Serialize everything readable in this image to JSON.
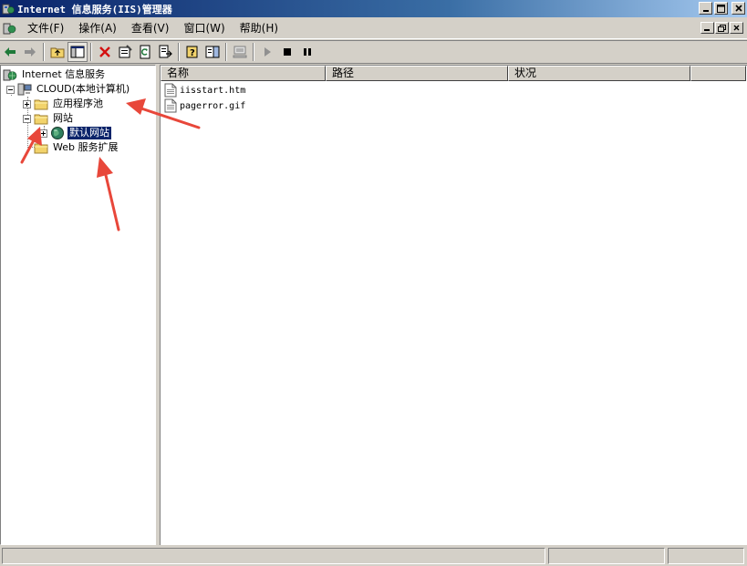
{
  "window": {
    "title": "Internet 信息服务(IIS)管理器"
  },
  "menu": [
    {
      "id": "file",
      "label": "文件(F)"
    },
    {
      "id": "action",
      "label": "操作(A)"
    },
    {
      "id": "view",
      "label": "查看(V)"
    },
    {
      "id": "window",
      "label": "窗口(W)"
    },
    {
      "id": "help",
      "label": "帮助(H)"
    }
  ],
  "tree": {
    "root": "Internet 信息服务",
    "computer": "CLOUD(本地计算机)",
    "app_pools": "应用程序池",
    "websites": "网站",
    "default_site": "默认网站",
    "web_extensions": "Web 服务扩展"
  },
  "list": {
    "columns": [
      "名称",
      "路径",
      "状况"
    ],
    "rows": [
      {
        "name": "iisstart.htm"
      },
      {
        "name": "pagerror.gif"
      }
    ]
  },
  "colors": {
    "annotation_arrow": "#e8473a",
    "selection": "#0a246a",
    "title_bar": "#0a246a"
  }
}
